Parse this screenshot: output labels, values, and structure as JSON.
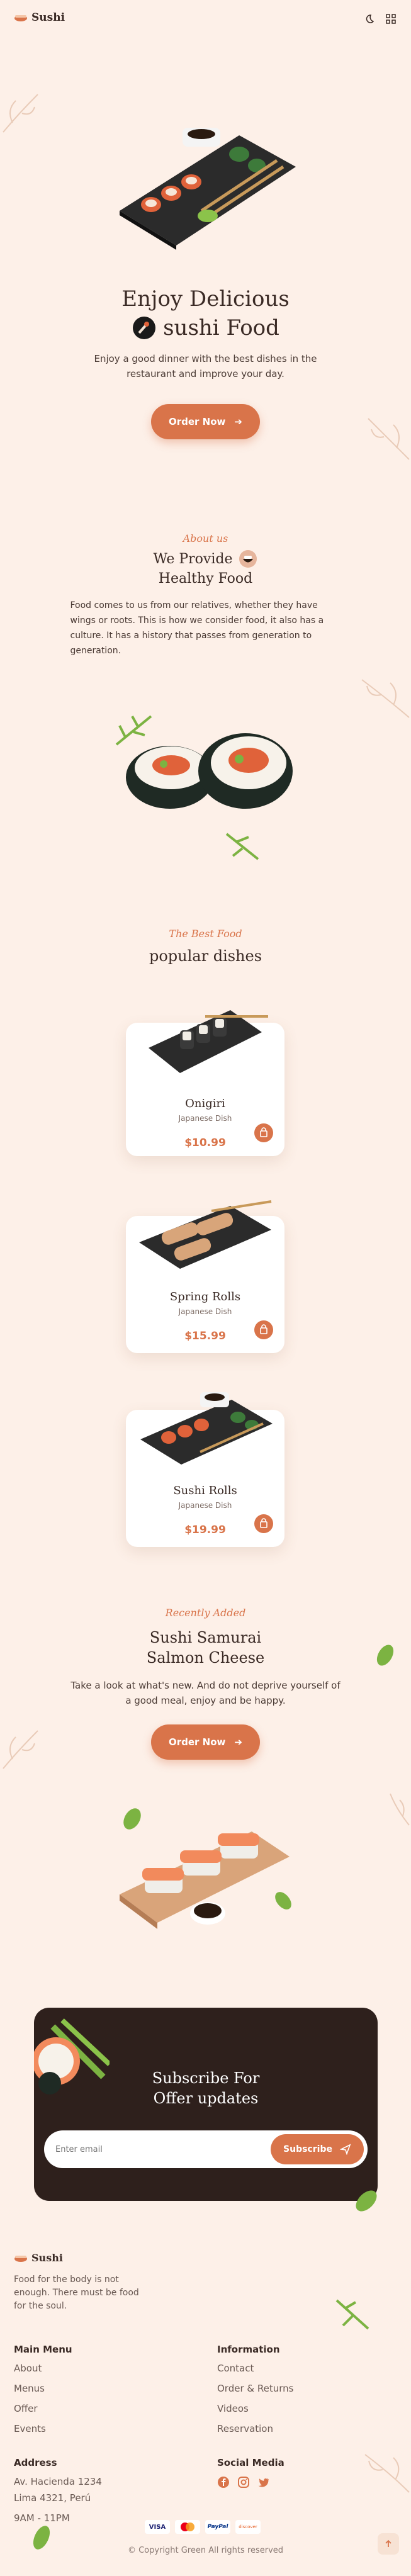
{
  "header": {
    "brand": "Sushi",
    "icons": [
      "moon-icon",
      "grid-icon"
    ]
  },
  "hero": {
    "title_line1": "Enjoy Delicious",
    "title_line2": "sushi Food",
    "text": "Enjoy a good dinner with the best dishes in the restaurant and improve your day.",
    "button": "Order Now"
  },
  "about": {
    "eyebrow": "About us",
    "title_line1": "We Provide",
    "title_line2": "Healthy Food",
    "text": "Food comes to us from our relatives, whether they have wings or roots. This is how we consider food, it also has a culture. It has a history that passes from generation to generation."
  },
  "popular": {
    "eyebrow": "The Best Food",
    "title": "popular dishes",
    "items": [
      {
        "name": "Onigiri",
        "category": "Japanese Dish",
        "price": "$10.99"
      },
      {
        "name": "Spring Rolls",
        "category": "Japanese Dish",
        "price": "$15.99"
      },
      {
        "name": "Sushi Rolls",
        "category": "Japanese Dish",
        "price": "$19.99"
      }
    ]
  },
  "recent": {
    "eyebrow": "Recently Added",
    "title_line1": "Sushi Samurai",
    "title_line2": "Salmon Cheese",
    "text": "Take a look at what's new. And do not deprive yourself of a good meal, enjoy and be happy.",
    "button": "Order Now"
  },
  "newsletter": {
    "title_line1": "Subscribe For",
    "title_line2": "Offer updates",
    "placeholder": "Enter email",
    "button": "Subscribe"
  },
  "footer": {
    "brand": "Sushi",
    "tagline": "Food for the body is not enough. There must be food for the soul.",
    "main_menu": {
      "title": "Main Menu",
      "links": [
        "About",
        "Menus",
        "Offer",
        "Events"
      ]
    },
    "information": {
      "title": "Information",
      "links": [
        "Contact",
        "Order & Returns",
        "Videos",
        "Reservation"
      ]
    },
    "address": {
      "title": "Address",
      "lines": [
        "Av. Hacienda 1234",
        "Lima 4321, Perú",
        "9AM - 11PM"
      ]
    },
    "social": {
      "title": "Social Media",
      "icons": [
        "facebook-icon",
        "instagram-icon",
        "twitter-icon"
      ]
    },
    "payments": [
      "VISA",
      "mastercard",
      "PayPal",
      "discover"
    ],
    "copyright": "© Copyright Green All rights reserved"
  },
  "colors": {
    "accent": "#d9744a",
    "background": "#fdf0e8",
    "dark": "#2e201c"
  }
}
